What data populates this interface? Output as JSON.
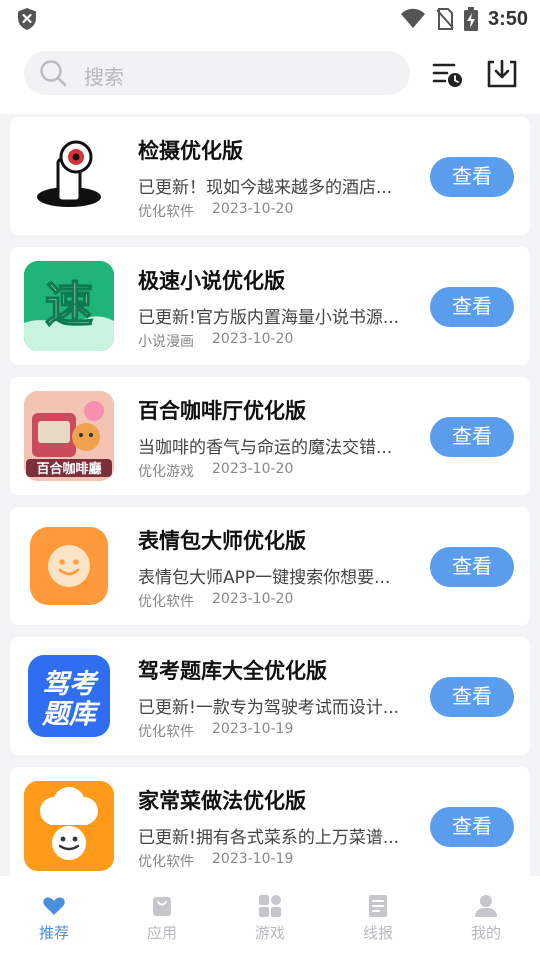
{
  "status_bar": {
    "time": "3:50"
  },
  "search": {
    "placeholder": "搜索"
  },
  "apps": [
    {
      "title": "检摄优化版",
      "desc": "已更新！现如今越来越多的酒店...",
      "category": "优化软件",
      "date": "2023-10-20",
      "button": "查看",
      "icon": "camera-scan-app-icon"
    },
    {
      "title": "极速小说优化版",
      "desc": "已更新!官方版内置海量小说书源...",
      "category": "小说漫画",
      "date": "2023-10-20",
      "button": "查看",
      "icon": "speed-novel-app-icon"
    },
    {
      "title": "百合咖啡厅优化版",
      "desc": "当咖啡的香气与命运的魔法交错...",
      "category": "优化游戏",
      "date": "2023-10-20",
      "button": "查看",
      "icon": "lily-cafe-app-icon",
      "icon_text": "百合咖啡廳"
    },
    {
      "title": "表情包大师优化版",
      "desc": "表情包大师APP一键搜索你想要...",
      "category": "优化软件",
      "date": "2023-10-20",
      "button": "查看",
      "icon": "smiley-app-icon"
    },
    {
      "title": "驾考题库大全优化版",
      "desc": "已更新!一款专为驾驶考试而设计...",
      "category": "优化软件",
      "date": "2023-10-19",
      "button": "查看",
      "icon": "driving-quiz-app-icon",
      "icon_text": "驾考题库"
    },
    {
      "title": "家常菜做法优化版",
      "desc": "已更新!拥有各式菜系的上万菜谱...",
      "category": "优化软件",
      "date": "2023-10-19",
      "button": "查看",
      "icon": "chef-app-icon"
    }
  ],
  "speed_icon_text": "速",
  "nav": [
    {
      "label": "推荐",
      "icon": "heart-icon",
      "active": true
    },
    {
      "label": "应用",
      "icon": "bag-icon",
      "active": false
    },
    {
      "label": "游戏",
      "icon": "grid-icon",
      "active": false
    },
    {
      "label": "线报",
      "icon": "document-icon",
      "active": false
    },
    {
      "label": "我的",
      "icon": "person-icon",
      "active": false
    }
  ],
  "colors": {
    "accent": "#4a8fe0",
    "button": "#5b9ded",
    "inactive": "#b7b9bd"
  }
}
